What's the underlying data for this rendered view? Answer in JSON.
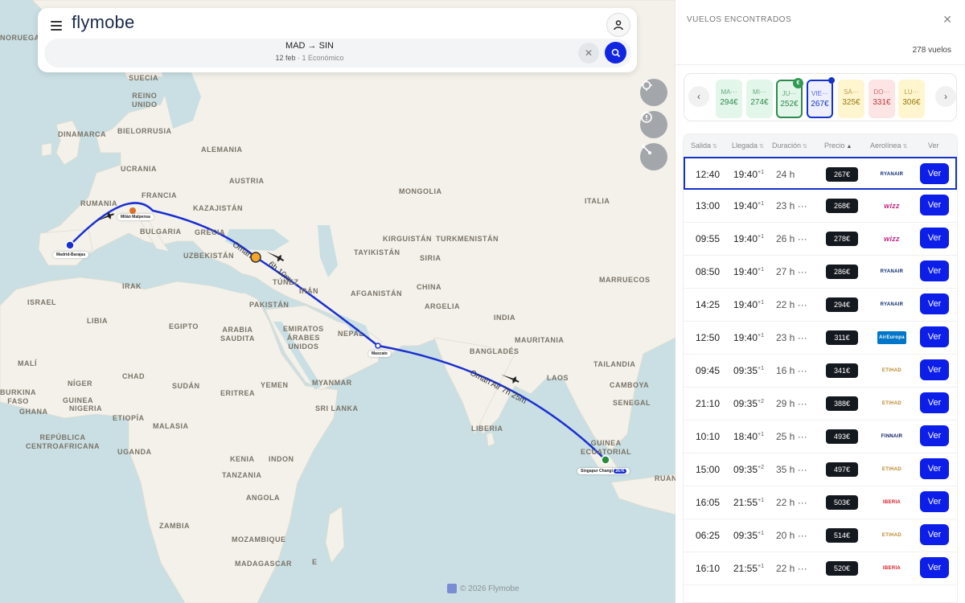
{
  "app": {
    "brand": "flymobe"
  },
  "search": {
    "route": "MAD → SIN",
    "date": "12 feb",
    "details": "1 Económico"
  },
  "map": {
    "countries": [
      {
        "name": "NORUEGA"
      },
      {
        "name": "SUECIA"
      },
      {
        "name": "REINO\nUNIDO"
      },
      {
        "name": "DINAMARCA"
      },
      {
        "name": "BIELORRUSIA"
      },
      {
        "name": "ALEMANIA"
      },
      {
        "name": "UCRANIA"
      },
      {
        "name": "AUSTRIA"
      },
      {
        "name": "FRANCIA"
      },
      {
        "name": "RUMANIA"
      },
      {
        "name": "KAZAJISTÁN"
      },
      {
        "name": "MONGOLIA"
      },
      {
        "name": "ITALIA"
      },
      {
        "name": "BULGARIA"
      },
      {
        "name": "GRECIA"
      },
      {
        "name": "UZBEKISTÁN"
      },
      {
        "name": "KIRGUISTÁN"
      },
      {
        "name": "TURKMENISTÁN"
      },
      {
        "name": "TAYIKISTÁN"
      },
      {
        "name": "SIRIA"
      },
      {
        "name": "TÚNEZ"
      },
      {
        "name": "IRAK"
      },
      {
        "name": "IRÁN"
      },
      {
        "name": "AFGANISTÁN"
      },
      {
        "name": "CHINA"
      },
      {
        "name": "MARRUECOS"
      },
      {
        "name": "ISRAEL"
      },
      {
        "name": "PAKISTÁN"
      },
      {
        "name": "ARGELIA"
      },
      {
        "name": "LIBIA"
      },
      {
        "name": "EGIPTO"
      },
      {
        "name": "ARABIA\nSAUDITA"
      },
      {
        "name": "EMIRATOS\nÁRABES\nUNIDOS"
      },
      {
        "name": "NEPAL"
      },
      {
        "name": "INDIA"
      },
      {
        "name": "BANGLADÉS"
      },
      {
        "name": "MAURITANIA"
      },
      {
        "name": "MALÍ"
      },
      {
        "name": "NÍGER"
      },
      {
        "name": "CHAD"
      },
      {
        "name": "SUDÁN"
      },
      {
        "name": "ERITREA"
      },
      {
        "name": "YEMEN"
      },
      {
        "name": "MYANMAR"
      },
      {
        "name": "LAOS"
      },
      {
        "name": "TAILANDIA"
      },
      {
        "name": "CAMBOYA"
      },
      {
        "name": "SENEGAL"
      },
      {
        "name": "BURKINA\nFASO"
      },
      {
        "name": "GUINEA"
      },
      {
        "name": "GHANA"
      },
      {
        "name": "NIGERIA"
      },
      {
        "name": "ETIOPÍA"
      },
      {
        "name": "SRI LANKA"
      },
      {
        "name": "LIBERIA"
      },
      {
        "name": "REPÚBLICA\nCENTROAFRICANA"
      },
      {
        "name": "MALASIA"
      },
      {
        "name": "GUINEA\nECUATORIAL"
      },
      {
        "name": "UGANDA"
      },
      {
        "name": "KENIA"
      },
      {
        "name": "INDON"
      },
      {
        "name": "RUANDA"
      },
      {
        "name": "TANZANIA"
      },
      {
        "name": "ANGOLA"
      },
      {
        "name": "ZAMBIA"
      },
      {
        "name": "MOZAMBIQUE"
      },
      {
        "name": "MADAGASCAR"
      },
      {
        "name": "E"
      }
    ],
    "airports": {
      "origin": "Madrid-Barajas",
      "stop1": "Milán Malpensa",
      "stop2": "Mascate",
      "dest": "Singapur Changi",
      "dest_tag": "267€"
    },
    "legs": {
      "leg1_airline": "Oman",
      "leg1_duration": "6h 10m",
      "leg2": "Oman Air 7h 25m"
    },
    "copyright": "© 2026 Flymobe"
  },
  "panel": {
    "title": "VUELOS ENCONTRADOS",
    "count": "278 vuelos",
    "dates": [
      {
        "day": "MA···",
        "price": "294€",
        "bg": "#e3f6ea",
        "fg": "#2f8a4e"
      },
      {
        "day": "MI···",
        "price": "274€",
        "bg": "#e3f6ea",
        "fg": "#2f8a4e"
      },
      {
        "day": "JU···",
        "price": "252€",
        "bg": "#e3f6ea",
        "fg": "#2f8a4e",
        "badge": "€"
      },
      {
        "day": "VIE···",
        "price": "267€",
        "bg": "#eef0ff",
        "fg": "#1533c9"
      },
      {
        "day": "SÁ···",
        "price": "325€",
        "bg": "#fff6cf",
        "fg": "#9a7a12"
      },
      {
        "day": "DO···",
        "price": "331€",
        "bg": "#fde5e5",
        "fg": "#c23b3b"
      },
      {
        "day": "LU···",
        "price": "306€",
        "bg": "#fff6cf",
        "fg": "#9a7a12"
      }
    ],
    "columns": {
      "salida": "Salida",
      "llegada": "Llegada",
      "duracion": "Duración",
      "precio": "Precio",
      "aerolinea": "Aerolínea",
      "ver": "Ver"
    },
    "flights": [
      {
        "dep": "12:40",
        "arr": "19:40",
        "plus": "+1",
        "dur": "24 h",
        "price": "267€",
        "airline": "RYANAIR",
        "logo_color": "#0a2a6b",
        "cta": "Ver"
      },
      {
        "dep": "13:00",
        "arr": "19:40",
        "plus": "+1",
        "dur": "23 h ···",
        "price": "268€",
        "airline": "wizz",
        "logo_color": "#c6237f",
        "cta": "Ver"
      },
      {
        "dep": "09:55",
        "arr": "19:40",
        "plus": "+1",
        "dur": "26 h ···",
        "price": "278€",
        "airline": "wizz",
        "logo_color": "#c6237f",
        "cta": "Ver"
      },
      {
        "dep": "08:50",
        "arr": "19:40",
        "plus": "+1",
        "dur": "27 h ···",
        "price": "286€",
        "airline": "RYANAIR",
        "logo_color": "#0a2a6b",
        "cta": "Ver"
      },
      {
        "dep": "14:25",
        "arr": "19:40",
        "plus": "+1",
        "dur": "22 h ···",
        "price": "294€",
        "airline": "RYANAIR",
        "logo_color": "#0a2a6b",
        "cta": "Ver"
      },
      {
        "dep": "12:50",
        "arr": "19:40",
        "plus": "+1",
        "dur": "23 h ···",
        "price": "311€",
        "airline": "AirEuropa",
        "logo_color": "#0077c8",
        "cta": "Ver"
      },
      {
        "dep": "09:45",
        "arr": "09:35",
        "plus": "+1",
        "dur": "16 h ···",
        "price": "341€",
        "airline": "ETIHAD",
        "logo_color": "#b8892c",
        "cta": "Ver"
      },
      {
        "dep": "21:10",
        "arr": "09:35",
        "plus": "+2",
        "dur": "29 h ···",
        "price": "388€",
        "airline": "ETIHAD",
        "logo_color": "#b8892c",
        "cta": "Ver"
      },
      {
        "dep": "10:10",
        "arr": "18:40",
        "plus": "+1",
        "dur": "25 h ···",
        "price": "493€",
        "airline": "FINNAIR",
        "logo_color": "#0b1560",
        "cta": "Ver"
      },
      {
        "dep": "15:00",
        "arr": "09:35",
        "plus": "+2",
        "dur": "35 h ···",
        "price": "497€",
        "airline": "ETIHAD",
        "logo_color": "#b8892c",
        "cta": "Ver"
      },
      {
        "dep": "16:05",
        "arr": "21:55",
        "plus": "+1",
        "dur": "22 h ···",
        "price": "503€",
        "airline": "IBERIA",
        "logo_color": "#d71920",
        "cta": "Ver"
      },
      {
        "dep": "06:25",
        "arr": "09:35",
        "plus": "+1",
        "dur": "20 h ···",
        "price": "514€",
        "airline": "ETIHAD",
        "logo_color": "#b8892c",
        "cta": "Ver"
      },
      {
        "dep": "16:10",
        "arr": "21:55",
        "plus": "+1",
        "dur": "22 h ···",
        "price": "520€",
        "airline": "IBERIA",
        "logo_color": "#d71920",
        "cta": "Ver"
      }
    ]
  }
}
